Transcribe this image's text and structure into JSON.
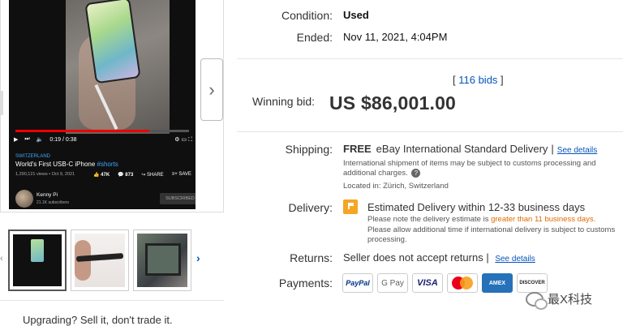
{
  "video": {
    "time": "0:19 / 0:38",
    "location": "SWITZERLAND",
    "title": "World's First USB-C iPhone",
    "hashtag": "#shorts",
    "meta": "1,290,121 views • Oct 9, 2021",
    "likes": "47K",
    "comments": "873",
    "share": "SHARE",
    "save": "SAVE",
    "channel": "Kenny Pi",
    "subscribers": "21.1K subscribers",
    "subscribed": "SUBSCRIBED"
  },
  "gallery": {
    "next_arrow": "›",
    "prev_arrow": "‹",
    "thumb_next_arrow": "›"
  },
  "upgrade": "Upgrading? Sell it, don't trade it.",
  "listing": {
    "condition_label": "Condition:",
    "condition_value": "Used",
    "ended_label": "Ended:",
    "ended_value": "Nov 11, 2021, 4:04PM",
    "bids_link": "116 bids",
    "winning_label": "Winning bid:",
    "winning_amount": "US $86,001.00",
    "shipping_label": "Shipping:",
    "shipping_free": "FREE",
    "shipping_method": "eBay International Standard Delivery",
    "see_details": "See details",
    "shipping_note": "International shipment of items may be subject to customs processing and additional charges.",
    "located": "Located in:  Zürich, Switzerland",
    "delivery_label": "Delivery:",
    "delivery_main": "Estimated Delivery within 12-33 business days",
    "delivery_note_a": "Please note the delivery estimate is ",
    "delivery_note_warn": "greater than 11 business days.",
    "delivery_note2": "Please allow additional time if international delivery is subject to customs processing.",
    "returns_label": "Returns:",
    "returns_value": "Seller does not accept returns",
    "payments_label": "Payments:",
    "payments": [
      "PayPal",
      "G Pay",
      "VISA",
      "",
      "AMEX",
      "DISCOVER"
    ]
  },
  "watermark": "最X科技",
  "colors": {
    "link": "#0654ba",
    "warning": "#dd6b00",
    "delivery_icon": "#f5a623"
  }
}
